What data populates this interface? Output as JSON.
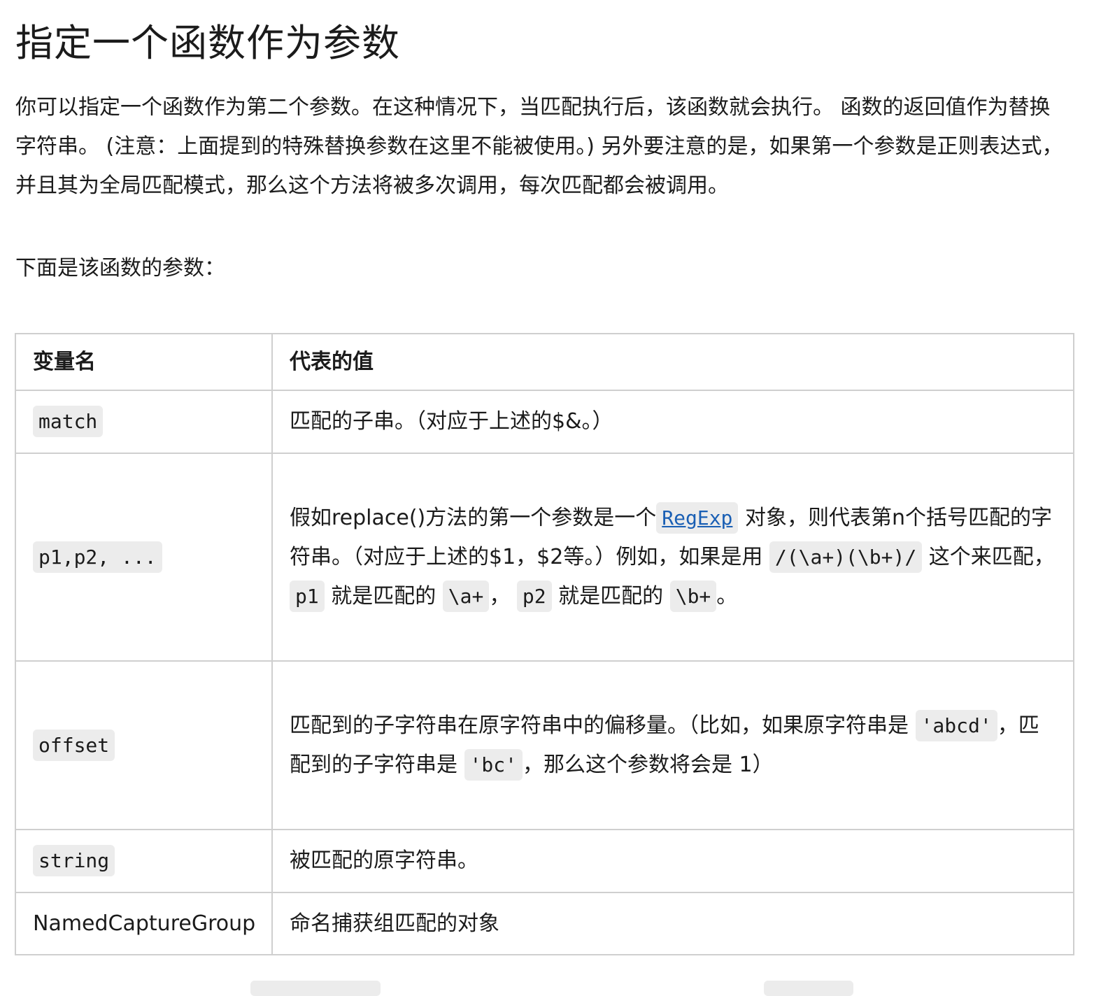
{
  "title": "指定一个函数作为参数",
  "intro": {
    "text": "你可以指定一个函数作为第二个参数。在这种情况下，当匹配执行后，该函数就会执行。 函数的返回值作为替换字符串。 (注意：上面提到的特殊替换参数在这里不能被使用。) 另外要注意的是，如果第一个参数是正则表达式，并且其为全局匹配模式，那么这个方法将被多次调用，每次匹配都会被调用。"
  },
  "params_heading": "下面是该函数的参数：",
  "table": {
    "headers": [
      "变量名",
      "代表的值"
    ],
    "rows": [
      {
        "name": "match",
        "desc": [
          "匹配的子串。（对应于上述的$&。）"
        ]
      },
      {
        "name": "p1,p2, ...",
        "desc": [
          "假如replace()方法的第一个参数是一个",
          "RegExp",
          " 对象，则代表第n个括号匹配的字符串。（对应于上述的$1，$2等。）例如，如果是用 ",
          "/(\\a+)(\\b+)/",
          " 这个来匹配， ",
          "p1",
          " 就是匹配的 ",
          "\\a+",
          "， ",
          "p2",
          " 就是匹配的 ",
          "\\b+",
          "。"
        ]
      },
      {
        "name": "offset",
        "desc": [
          "匹配到的子字符串在原字符串中的偏移量。（比如，如果原字符串是 ",
          "'abcd'",
          "，匹配到的子字符串是 ",
          "'bc'",
          "，那么这个参数将会是 1）"
        ]
      },
      {
        "name": "string",
        "desc": [
          "被匹配的原字符串。"
        ]
      },
      {
        "name": "NamedCaptureGroup",
        "desc": [
          "命名捕获组匹配的对象"
        ]
      }
    ]
  }
}
